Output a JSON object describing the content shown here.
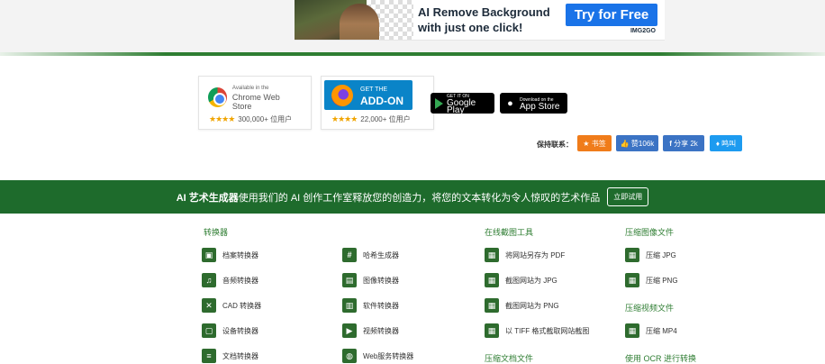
{
  "ad": {
    "headline": "AI Remove Background with just one click!",
    "cta": "Try for Free",
    "logo": "IMG2GO"
  },
  "stores": {
    "chrome": {
      "small": "Available in the",
      "name": "Chrome Web Store",
      "stars": "★★★★",
      "users": "300,000+ 位用户"
    },
    "firefox": {
      "small": "GET THE",
      "name": "ADD-ON",
      "stars": "★★★★",
      "users": "22,000+ 位用户"
    },
    "google_play": {
      "small": "GET IT ON",
      "name": "Google Play"
    },
    "app_store": {
      "small": "Download on the",
      "name": "App Store"
    }
  },
  "share": {
    "label": "保持联系：",
    "buttons": [
      {
        "label": "书签",
        "icon": "star-icon",
        "color": "#f07c1a"
      },
      {
        "label": "赞106k",
        "icon": "thumbs-up-icon",
        "color": "#3b73c4"
      },
      {
        "label": "分享 2k",
        "icon": "facebook-icon",
        "color": "#3b73c4"
      },
      {
        "label": "鸣叫",
        "icon": "twitter-icon",
        "color": "#1d9bf0"
      }
    ]
  },
  "promo": {
    "brand": "AI 艺术生成器",
    "text": "使用我们的 AI 创作工作室释放您的创造力，将您的文本转化为令人惊叹的艺术作品",
    "button": "立即试用"
  },
  "columns": {
    "col1": {
      "title": "转换器",
      "items": [
        {
          "label": "档案转换器",
          "icon": "archive-icon"
        },
        {
          "label": "音频转换器",
          "icon": "music-icon"
        },
        {
          "label": "CAD 转换器",
          "icon": "cad-icon"
        },
        {
          "label": "设备转换器",
          "icon": "device-icon"
        },
        {
          "label": "文档转换器",
          "icon": "document-icon"
        }
      ]
    },
    "col2": {
      "items": [
        {
          "label": "哈希生成器",
          "icon": "hash-icon"
        },
        {
          "label": "图像转换器",
          "icon": "image-icon"
        },
        {
          "label": "软件转换器",
          "icon": "software-icon"
        },
        {
          "label": "视频转换器",
          "icon": "video-icon"
        },
        {
          "label": "Web服务转换器",
          "icon": "globe-icon"
        }
      ]
    },
    "col3": {
      "title": "在线截图工具",
      "items": [
        {
          "label": "将网站另存为 PDF",
          "icon": "file-icon"
        },
        {
          "label": "截图网站为 JPG",
          "icon": "file-icon"
        },
        {
          "label": "截图网站为 PNG",
          "icon": "file-icon"
        },
        {
          "label": "以 TIFF 格式截取网站截图",
          "icon": "file-icon"
        }
      ],
      "title2": "压缩文档文件"
    },
    "col4": {
      "title": "压缩图像文件",
      "items": [
        {
          "label": "压缩 JPG",
          "icon": "file-icon"
        },
        {
          "label": "压缩 PNG",
          "icon": "file-icon"
        }
      ],
      "title2": "压缩视频文件",
      "items2": [
        {
          "label": "压缩 MP4",
          "icon": "file-icon"
        }
      ],
      "title3": "使用 OCR 进行转换"
    }
  }
}
